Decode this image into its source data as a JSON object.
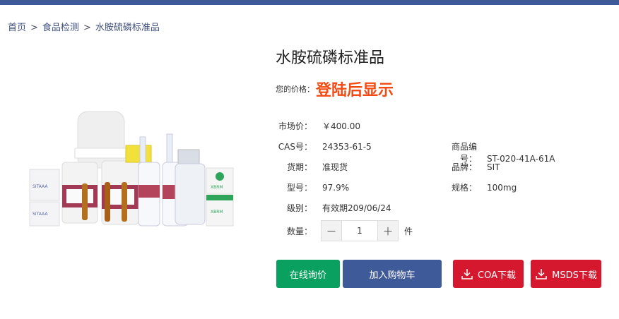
{
  "breadcrumb": {
    "home": "首页",
    "category": "食品检测",
    "current": "水胺硫磷标准品",
    "separator": ">"
  },
  "product": {
    "title": "水胺硫磷标准品",
    "price_label": "您的价格：",
    "price_value": "登陆后显示",
    "market_price_label": "市场价：",
    "market_price": "￥400.00",
    "cas_label": "CAS号：",
    "cas": "24353-61-5",
    "product_code_label": "商品编号：",
    "product_code": "ST-020-41A-61A",
    "supply_label": "货期：",
    "supply": "准现货",
    "brand_label": "品牌：",
    "brand": "SIT",
    "model_label": "型号：",
    "model": "97.9%",
    "spec_label": "规格：",
    "spec": "100mg",
    "grade_label": "级别：",
    "grade": "有效期209/06/24"
  },
  "quantity": {
    "label": "数量：",
    "minus": "－",
    "value": "1",
    "plus": "＋",
    "unit": "件"
  },
  "actions": {
    "inquiry": "在线询价",
    "cart": "加入购物车",
    "coa": "COA下载",
    "msds": "MSDS下载"
  },
  "image_labels": {
    "box_brand": "SITAAA",
    "xbrm": "XBRM"
  },
  "colors": {
    "nav": "#3f5a98",
    "price": "#f24a12",
    "green": "#0aa160",
    "red": "#d6182f"
  }
}
